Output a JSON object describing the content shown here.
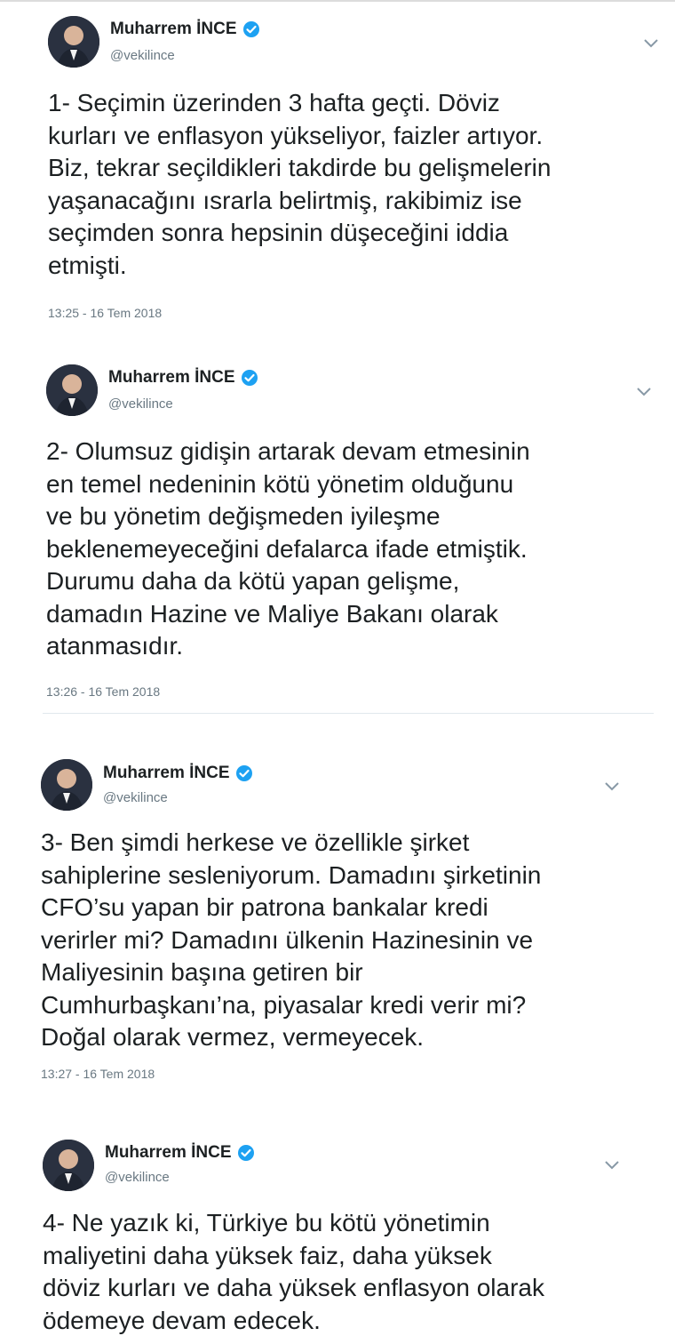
{
  "tweets": [
    {
      "name": "Muharrem İNCE",
      "handle": "@vekilince",
      "text": "1- Seçimin üzerinden 3 hafta geçti. Döviz\nkurları ve enflasyon yükseliyor, faizler artıyor.\nBiz, tekrar seçildikleri takdirde bu gelişmelerin\nyaşanacağını ısrarla belirtmiş, rakibimiz ise\nseçimden sonra hepsinin düşeceğini iddia\netmişti.",
      "timestamp": "13:25 - 16 Tem 2018"
    },
    {
      "name": "Muharrem İNCE",
      "handle": "@vekilince",
      "text": "2- Olumsuz gidişin artarak devam etmesinin\nen temel nedeninin kötü yönetim olduğunu\nve bu yönetim değişmeden iyileşme\nbeklenemeyeceğini defalarca ifade etmiştik.\nDurumu daha da kötü yapan gelişme,\ndamadın Hazine ve Maliye Bakanı olarak\natanmasıdır.",
      "timestamp": "13:26 - 16 Tem 2018"
    },
    {
      "name": "Muharrem İNCE",
      "handle": "@vekilince",
      "text": "3- Ben şimdi herkese ve özellikle şirket\nsahiplerine sesleniyorum. Damadını şirketinin\nCFO’su yapan bir patrona bankalar kredi\nverirler mi? Damadını ülkenin Hazinesinin ve\nMaliyesinin başına getiren bir\nCumhurbaşkanı’na, piyasalar kredi verir mi?\nDoğal olarak vermez, vermeyecek.",
      "timestamp": "13:27 - 16 Tem 2018"
    },
    {
      "name": "Muharrem İNCE",
      "handle": "@vekilince",
      "text": "4- Ne yazık ki, Türkiye bu kötü yönetimin\nmaliyetini daha yüksek faiz, daha yüksek\ndöviz kurları ve daha yüksek enflasyon olarak\nödemeye devam edecek."
    }
  ],
  "icons": {
    "verified": "verified-badge-icon",
    "menu": "chevron-down-icon"
  },
  "colors": {
    "verified": "#1da1f2",
    "text": "#1c2022",
    "muted": "#697882",
    "divider": "#e1e8ed"
  }
}
